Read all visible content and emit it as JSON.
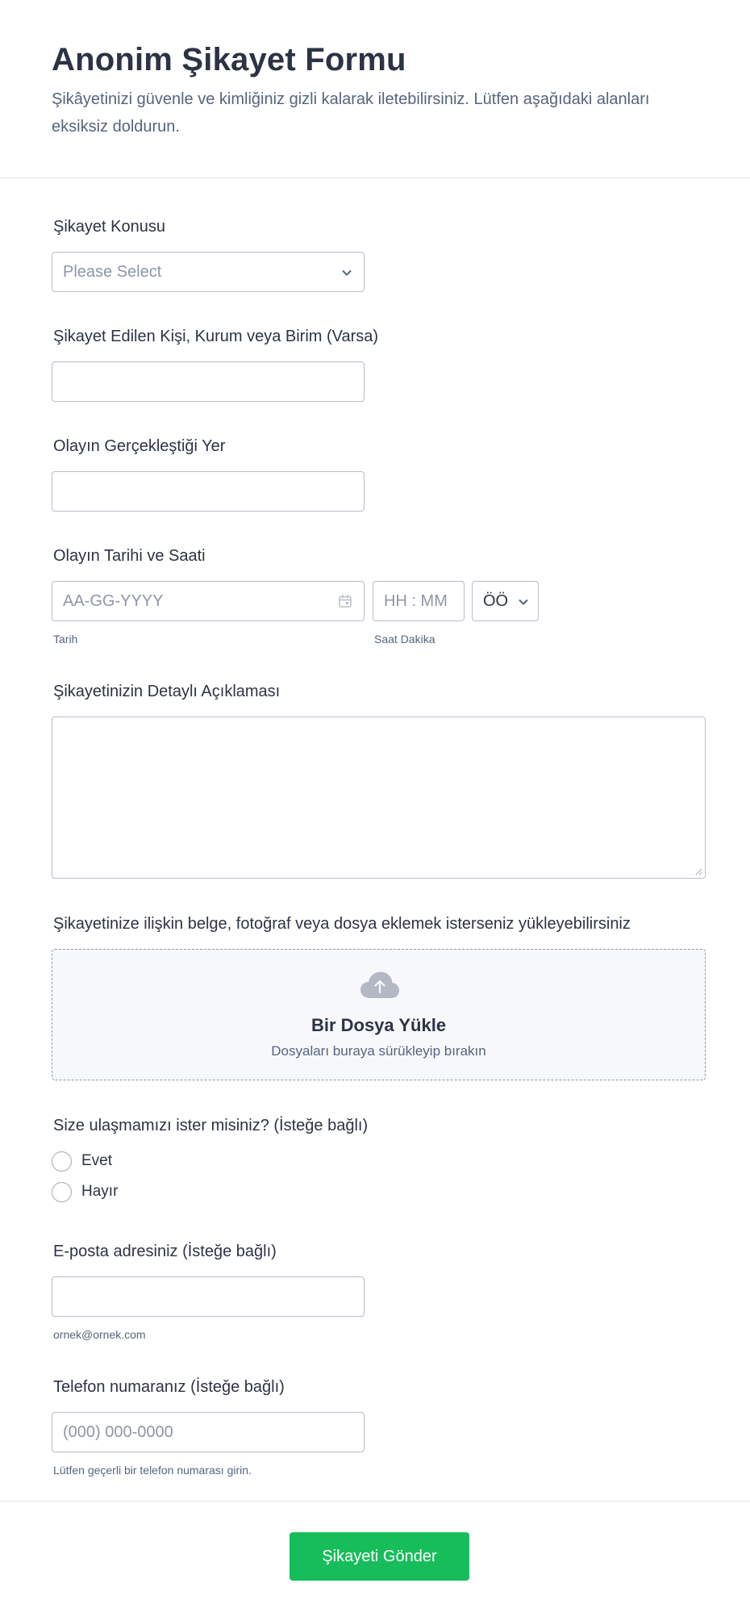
{
  "form": {
    "title": "Anonim Şikayet Formu",
    "subtitle": "Şikâyetinizi güvenle ve kimliğiniz gizli kalarak iletebilirsiniz. Lütfen aşağıdaki alanları eksiksiz doldurun."
  },
  "subject": {
    "label": "Şikayet Konusu",
    "selected": "Please Select"
  },
  "target": {
    "label": "Şikayet Edilen Kişi, Kurum veya Birim (Varsa)",
    "value": ""
  },
  "location": {
    "label": "Olayın Gerçekleştiği Yer",
    "value": ""
  },
  "datetime": {
    "label": "Olayın Tarihi ve Saati",
    "date_placeholder": "AA-GG-YYYY",
    "date_sublabel": "Tarih",
    "time_placeholder": "HH : MM",
    "time_sublabel": "Saat Dakika",
    "ampm_selected": "ÖÖ"
  },
  "details": {
    "label": "Şikayetinizin Detaylı Açıklaması",
    "value": ""
  },
  "upload": {
    "label": "Şikayetinize ilişkin belge, fotoğraf veya dosya eklemek isterseniz yükleyebilirsiniz",
    "title": "Bir Dosya Yükle",
    "subtitle": "Dosyaları buraya sürükleyip bırakın"
  },
  "contact": {
    "label": "Size ulaşmamızı ister misiniz? (İsteğe bağlı)",
    "options": [
      "Evet",
      "Hayır"
    ]
  },
  "email": {
    "label": "E-posta adresiniz (İsteğe bağlı)",
    "value": "",
    "sublabel": "ornek@ornek.com"
  },
  "phone": {
    "label": "Telefon numaranız (İsteğe bağlı)",
    "placeholder": "(000) 000-0000",
    "sublabel": "Lütfen geçerli bir telefon numarası girin."
  },
  "submit": {
    "label": "Şikayeti Gönder"
  },
  "colors": {
    "submit_green": "#18bd5b",
    "text_dark": "#2c3345",
    "text_muted": "#57647e",
    "border": "#b8bdc9"
  }
}
